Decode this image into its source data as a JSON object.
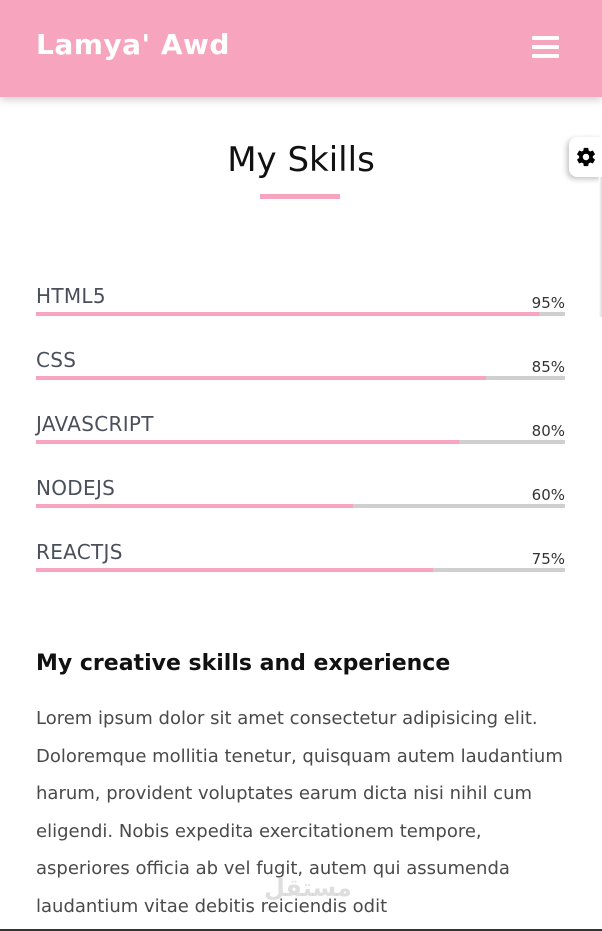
{
  "navbar": {
    "brand": "Lamya' Awd",
    "menu_icon": "hamburger-menu-icon",
    "background_color": "#f7a5bf"
  },
  "settings": {
    "icon": "gear-icon"
  },
  "skills_section": {
    "title": "My Skills",
    "accent_color": "#f7a5bf",
    "skills": [
      {
        "name": "HTML5",
        "percent_label": "95%",
        "level": 0.95
      },
      {
        "name": "CSS",
        "percent_label": "85%",
        "level": 0.85
      },
      {
        "name": "JAVASCRIPT",
        "percent_label": "80%",
        "level": 0.8
      },
      {
        "name": "NODEJS",
        "percent_label": "60%",
        "level": 0.6
      },
      {
        "name": "REACTJS",
        "percent_label": "75%",
        "level": 0.75
      }
    ]
  },
  "experience": {
    "heading": "My creative skills and experience",
    "body": "Lorem ipsum dolor sit amet consectetur adipisicing elit. Doloremque mollitia tenetur, quisquam autem laudantium harum, provident voluptates earum dicta nisi nihil cum eligendi. Nobis expedita exercitationem tempore, asperiores officia ab vel fugit, autem qui assumenda laudantium vitae debitis reiciendis odit"
  },
  "watermark": "مستقل"
}
